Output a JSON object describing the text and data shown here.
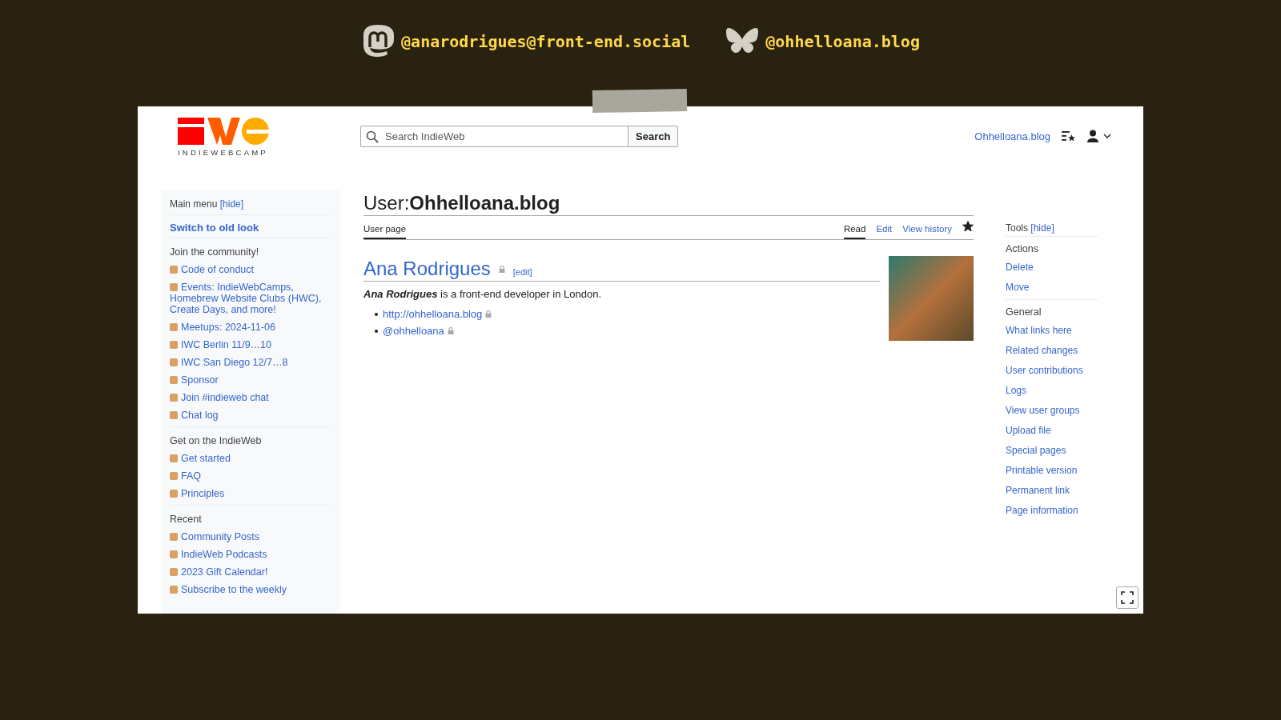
{
  "social": [
    {
      "kind": "mastodon",
      "handle": "@anarodrigues@front-end.social"
    },
    {
      "kind": "butterfly",
      "handle": "@ohhelloana.blog"
    }
  ],
  "header": {
    "logo_text": "INDIEWEBCAMP",
    "search": {
      "placeholder": "Search IndieWeb",
      "button": "Search"
    },
    "user_link": "Ohhelloana.blog"
  },
  "main_menu": {
    "title": "Main menu",
    "hide": "[hide]",
    "switch": "Switch to old look",
    "sections": [
      {
        "heading": "Join the community!",
        "items": [
          "Code of conduct",
          "Events: IndieWebCamps, Homebrew Website Clubs (HWC), Create Days, and more!",
          "Meetups: 2024-11-06",
          "IWC Berlin 11/9…10",
          "IWC San Diego 12/7…8",
          "Sponsor",
          "Join #indieweb chat",
          "Chat log"
        ]
      },
      {
        "heading": "Get on the IndieWeb",
        "items": [
          "Get started",
          "FAQ",
          "Principles"
        ]
      },
      {
        "heading": "Recent",
        "items": [
          "Community Posts",
          "IndieWeb Podcasts",
          "2023 Gift Calendar!",
          "Subscribe to the weekly"
        ]
      }
    ]
  },
  "page": {
    "namespace": "User:",
    "title": "Ohhelloana.blog",
    "left_tabs": [
      {
        "label": "User page",
        "selected": true
      }
    ],
    "right_tabs": [
      {
        "label": "Read",
        "selected": true
      },
      {
        "label": "Edit",
        "selected": false
      },
      {
        "label": "View history",
        "selected": false
      }
    ],
    "watched": true,
    "heading": "Ana Rodrigues",
    "edit": "[edit]",
    "intro": "**Ana Rodrigues** is a front-end developer in London.",
    "links": [
      "http://ohhelloana.blog",
      "@ohhelloana"
    ]
  },
  "tools": {
    "title": "Tools",
    "hide": "[hide]",
    "sections": [
      {
        "heading": "Actions",
        "items": [
          "Delete",
          "Move"
        ]
      },
      {
        "heading": "General",
        "items": [
          "What links here",
          "Related changes",
          "User contributions",
          "Logs",
          "View user groups",
          "Upload file",
          "Special pages",
          "Printable version",
          "Permanent link",
          "Page information"
        ]
      }
    ]
  }
}
